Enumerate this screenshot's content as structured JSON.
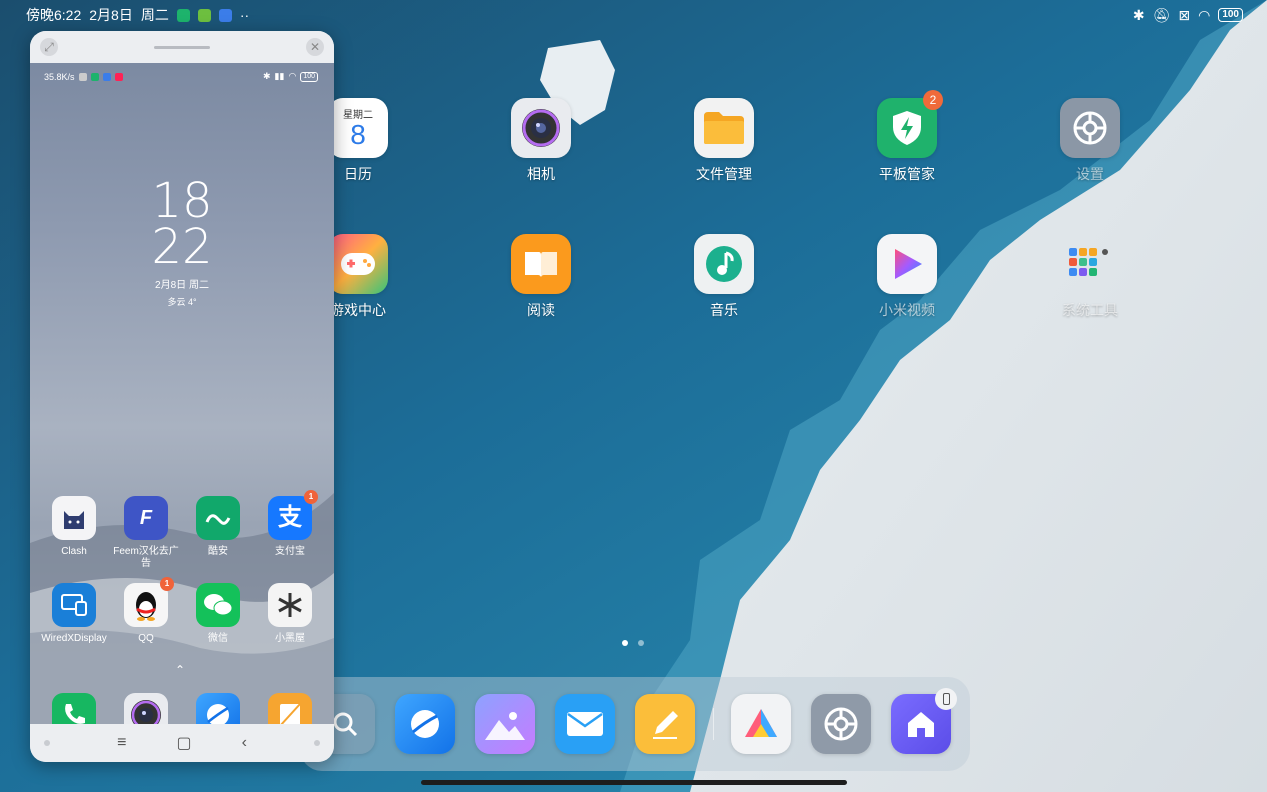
{
  "status_bar": {
    "time": "傍晚6:22",
    "date": "2月8日",
    "weekday": "周二",
    "more": "··",
    "battery": "100"
  },
  "phone_window": {
    "status": {
      "speed": "35.8K/s",
      "battery": "100"
    },
    "clock": {
      "hour": "18",
      "minute": "22",
      "date": "2月8日 周二",
      "weather": "多云 4°"
    },
    "apps": [
      {
        "label": "Clash",
        "badge": ""
      },
      {
        "label": "Feem汉化去广告",
        "badge": ""
      },
      {
        "label": "酷安",
        "badge": ""
      },
      {
        "label": "支付宝",
        "badge": "1"
      },
      {
        "label": "WiredXDisplay",
        "badge": ""
      },
      {
        "label": "QQ",
        "badge": "1"
      },
      {
        "label": "微信",
        "badge": ""
      },
      {
        "label": "小黑屋",
        "badge": ""
      }
    ],
    "nav": {
      "menu": "≡",
      "home": "▢",
      "back": "‹"
    }
  },
  "desktop": {
    "apps": [
      {
        "label": "日历",
        "weekday": "星期二",
        "day": "8"
      },
      {
        "label": "相机"
      },
      {
        "label": "文件管理"
      },
      {
        "label": "平板管家",
        "badge": "2"
      },
      {
        "label": "设置"
      },
      {
        "label": "游戏中心"
      },
      {
        "label": "阅读"
      },
      {
        "label": "音乐"
      },
      {
        "label": "小米视频"
      },
      {
        "label": "系统工具"
      }
    ]
  },
  "colors": {
    "badge": "#f06a3a",
    "security_green": "#20b26b",
    "files_orange": "#f7a928"
  }
}
